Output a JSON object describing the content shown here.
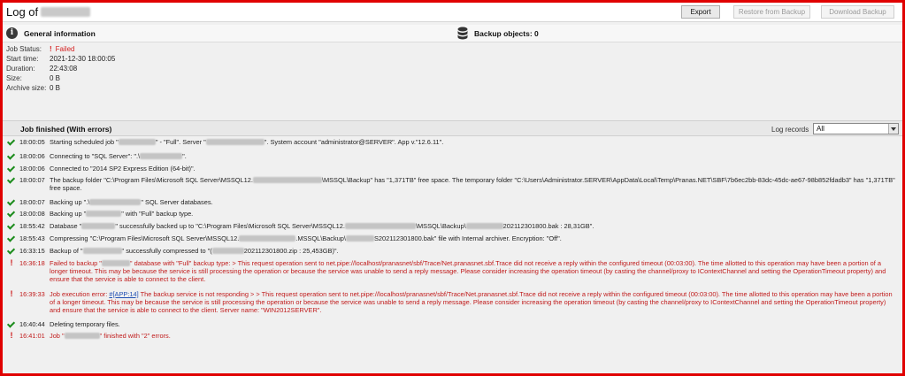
{
  "header": {
    "title_prefix": "Log of",
    "export_label": "Export",
    "restore_label": "Restore from Backup",
    "download_label": "Download Backup"
  },
  "general": {
    "title": "General information",
    "backup_objects": "Backup objects: 0",
    "job_status_label": "Job Status:",
    "job_status_value": "Failed",
    "start_time_label": "Start time:",
    "start_time_value": "2021-12-30 18:00:05",
    "duration_label": "Duration:",
    "duration_value": "22:43:08",
    "size_label": "Size:",
    "size_value": "0 B",
    "archive_size_label": "Archive size:",
    "archive_size_value": "0 B"
  },
  "job": {
    "title": "Job finished (With errors)",
    "log_records_label": "Log records",
    "log_records_value": "All"
  },
  "log": [
    {
      "time": "18:00:05",
      "status": "ok",
      "t1": "Starting scheduled job \"",
      "t2": "\" - \"Full\". Server \"",
      "t3": "\". System account \"administrator@SERVER\". App v.\"12.6.11\"."
    },
    {
      "time": "18:00:06",
      "status": "ok",
      "t1": "Connecting to \"SQL Server\": \".\\",
      "t2": "\"."
    },
    {
      "time": "18:00:06",
      "status": "ok",
      "t1": "Connected to \"2014 SP2 Express Edition (64-bit)\"."
    },
    {
      "time": "18:00:07",
      "status": "ok",
      "t1": "The backup folder \"C:\\Program Files\\Microsoft SQL Server\\MSSQL12.",
      "t2": "\\MSSQL\\Backup\" has \"1,371TB\" free space. The temporary folder \"C:\\Users\\Administrator.SERVER\\AppData\\Local\\Temp\\Pranas.NET\\SBF\\7b6ec2bb-83dc-45dc-ae67-98b852fdadb3\" has \"1,371TB\" free space."
    },
    {
      "time": "18:00:07",
      "status": "ok",
      "t1": "Backing up \".\\",
      "t2": "\" SQL Server databases."
    },
    {
      "time": "18:00:08",
      "status": "ok",
      "t1": "Backing up \"",
      "t2": "\" with \"Full\" backup type."
    },
    {
      "time": "18:55:42",
      "status": "ok",
      "t1": "Database \"",
      "t2": "\" successfully backed up to \"C:\\Program Files\\Microsoft SQL Server\\MSSQL12.",
      "t3": "\\MSSQL\\Backup\\",
      "t4": "202112301800.bak : 28,31GB\"."
    },
    {
      "time": "18:55:43",
      "status": "ok",
      "t1": "Compressing \"C:\\Program Files\\Microsoft SQL Server\\MSSQL12.",
      "t2": ".MSSQL\\Backup\\",
      "t3": "S202112301800.bak\" file with Internal archiver. Encryption: \"Off\"."
    },
    {
      "time": "16:33:15",
      "status": "ok",
      "t1": "Backup of \"",
      "t2": "\" successfully compressed to \"(",
      "t3": "202112301800.zip : 25,453GB)\"."
    },
    {
      "time": "16:36:18",
      "status": "error",
      "t1": "Failed to backup \"",
      "t2": "\" database with \"Full\" backup type:  > This request operation sent to net.pipe://localhost/pranasnet/sbf/Trace/Net.pranasnet.sbf.Trace did not receive a reply within the configured timeout (00:03:00).  The time allotted to this operation may have been a portion of a longer timeout.  This may be because the service is still processing the operation or because the service was unable to send a reply message.  Please consider increasing the operation timeout (by casting the channel/proxy to IContextChannel and setting the OperationTimeout property) and ensure that the service is able to connect to the client."
    },
    {
      "time": "16:39:33",
      "status": "error",
      "t1": "Job execution error: ",
      "link": "#[APP:14]",
      "t2": " The backup service is not responding >  > This request operation sent to net.pipe://localhost/pranasnet/sbf/Trace/Net.pranasnet.sbf.Trace did not receive a reply within the configured timeout (00:03:00).  The time allotted to this operation may have been a portion of a longer timeout.  This may be because the service is still processing the operation or because the service was unable to send a reply message.  Please consider increasing the operation timeout (by casting the channel/proxy to IContextChannel and setting the OperationTimeout property) and ensure that the service is able to connect to the client. Server name: \"WIN2012SERVER\"."
    },
    {
      "time": "16:40:44",
      "status": "ok",
      "t1": "Deleting temporary files."
    },
    {
      "time": "16:41:01",
      "status": "error",
      "t1": "Job \"",
      "t2": "\" finished with \"2\" errors."
    }
  ]
}
